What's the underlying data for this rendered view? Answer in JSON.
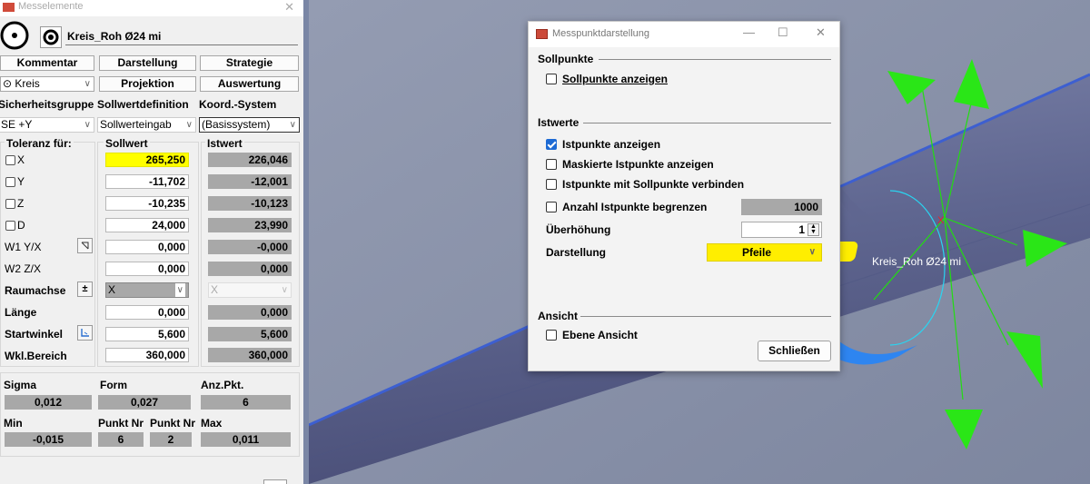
{
  "left_panel": {
    "window_title": "Messelemente",
    "close_glyph": "✕",
    "element_name": "Kreis_Roh Ø24 mi",
    "buttons": {
      "kommentar": "Kommentar",
      "darstellung": "Darstellung",
      "strategie": "Strategie",
      "projektion": "Projektion",
      "auswertung": "Auswertung"
    },
    "type_combo": "⊙ Kreis",
    "headers": {
      "sicherheit": "Sicherheitsgruppe",
      "sollwertdef": "Sollwertdefinition",
      "koord": "Koord.-System"
    },
    "combos": {
      "sicherheit": "SE +Y",
      "sollwertdef": "Sollwerteingab",
      "koord": "(Basissystem)"
    },
    "columns": {
      "toleranz": "Toleranz für:",
      "soll": "Sollwert",
      "ist": "Istwert"
    },
    "rows": [
      {
        "label": "X",
        "soll": "265,250",
        "ist": "226,046"
      },
      {
        "label": "Y",
        "soll": "-11,702",
        "ist": "-12,001"
      },
      {
        "label": "Z",
        "soll": "-10,235",
        "ist": "-10,123"
      },
      {
        "label": "D",
        "soll": "24,000",
        "ist": "23,990"
      },
      {
        "label": "W1 Y/X",
        "soll": "0,000",
        "ist": "-0,000"
      },
      {
        "label": "W2 Z/X",
        "soll": "0,000",
        "ist": "0,000"
      },
      {
        "label": "Raumachse",
        "soll": "X",
        "ist": "X"
      },
      {
        "label": "Länge",
        "soll": "0,000",
        "ist": "0,000"
      },
      {
        "label": "Startwinkel",
        "soll": "5,600",
        "ist": "5,600"
      },
      {
        "label": "Wkl.Bereich",
        "soll": "360,000",
        "ist": "360,000"
      }
    ],
    "raumachse_btn": "±",
    "stats": {
      "sigma_label": "Sigma",
      "sigma": "0,012",
      "form_label": "Form",
      "form": "0,027",
      "anz_label": "Anz.Pkt.",
      "anz": "6",
      "min_label": "Min",
      "min": "-0,015",
      "punktnr1_label": "Punkt Nr",
      "punktnr1": "6",
      "punktnr2_label": "Punkt Nr",
      "punktnr2": "2",
      "max_label": "Max",
      "max": "0,011"
    }
  },
  "dialog": {
    "title": "Messpunktdarstellung",
    "sections": {
      "sollpunkte": "Sollpunkte",
      "istwerte": "Istwerte",
      "ansicht": "Ansicht"
    },
    "options": {
      "sollpunkte_anzeigen": "Sollpunkte anzeigen",
      "istpunkte_anzeigen": "Istpunkte anzeigen",
      "maskierte": "Maskierte Istpunkte anzeigen",
      "verbinden": "Istpunkte mit Sollpunkte verbinden",
      "begrenzen": "Anzahl Istpunkte begrenzen",
      "ebene": "Ebene Ansicht"
    },
    "checked": {
      "sollpunkte_anzeigen": false,
      "istpunkte_anzeigen": true,
      "maskierte": false,
      "verbinden": false,
      "begrenzen": false,
      "ebene": false
    },
    "begrenzen_value": "1000",
    "ueberhoehung_label": "Überhöhung",
    "ueberhoehung_value": "1",
    "darstellung_label": "Darstellung",
    "darstellung_value": "Pfeile",
    "close_button": "Schließen"
  },
  "viewport": {
    "element_label": "Kreis_Roh Ø24 mi",
    "center_marker": "X",
    "colors": {
      "background": "#8a93ab",
      "cylinder": "#5f6690",
      "arrows": "#22dd11",
      "circle": "#2a8ef0"
    }
  }
}
